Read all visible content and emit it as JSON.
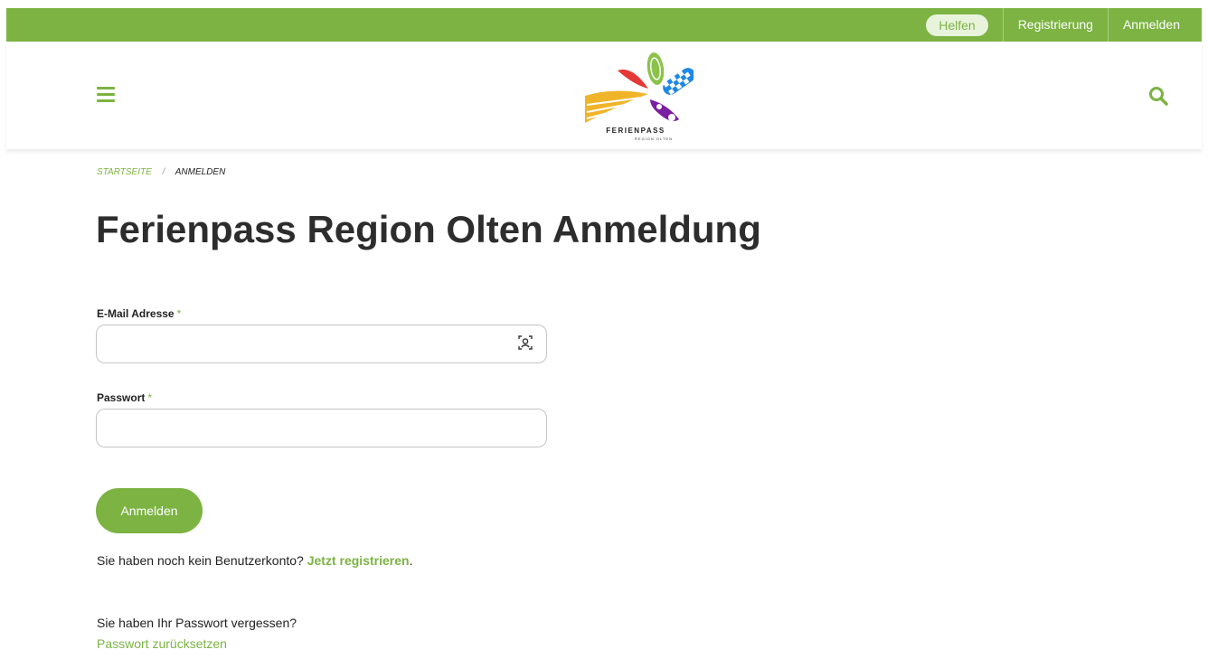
{
  "topbar": {
    "help_label": "Helfen",
    "register_label": "Registrierung",
    "login_label": "Anmelden"
  },
  "header": {
    "menu_icon": "hamburger-menu-icon",
    "search_icon": "search-icon",
    "logo_text": "FERIENPASS",
    "logo_subtext": "REGION OLTEN"
  },
  "breadcrumb": {
    "home": "STARTSEITE",
    "separator": "/",
    "current": "ANMELDEN"
  },
  "page_title": "Ferienpass Region Olten Anmeldung",
  "form": {
    "email_label": "E-Mail Adresse",
    "email_value": "",
    "password_label": "Passwort",
    "password_value": "",
    "required_mark": "*",
    "submit_label": "Anmelden"
  },
  "register_prompt": {
    "text": "Sie haben noch kein Benutzerkonto?",
    "link": "Jetzt registrieren",
    "suffix": "."
  },
  "forgot": {
    "text": "Sie haben Ihr Passwort vergessen?",
    "link": "Passwort zurücksetzen"
  },
  "colors": {
    "brand_green": "#7cb342",
    "title": "#2d2d2d",
    "border": "#c4c4c4"
  }
}
